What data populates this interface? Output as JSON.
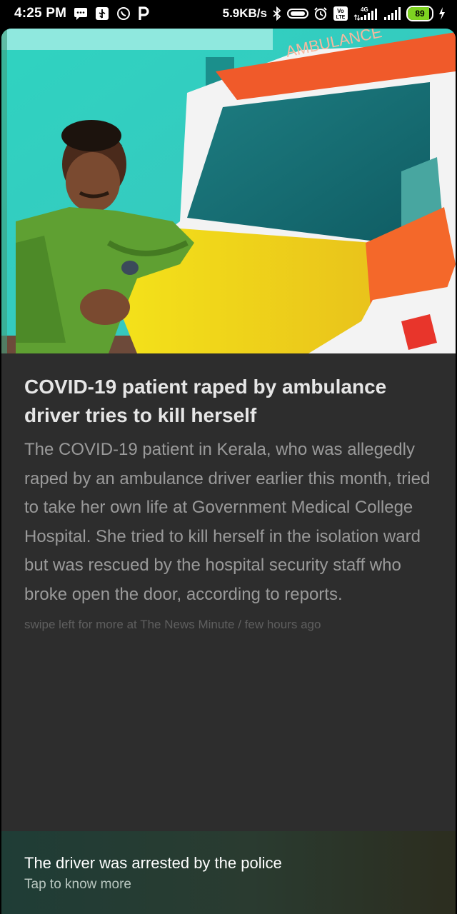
{
  "status_bar": {
    "time": "4:25 PM",
    "net_speed": "5.9KB/s",
    "battery_level": "89",
    "network_type": "4G",
    "volte_label": "Vo LTE",
    "icons": [
      "message-icon",
      "usb-icon",
      "whatsapp-icon",
      "p-icon",
      "bluetooth-icon",
      "vpn-key-icon",
      "alarm-icon",
      "volte-icon",
      "signal-icon",
      "signal-icon-2",
      "battery-icon",
      "charging-icon"
    ]
  },
  "article": {
    "title": "COVID-19 patient raped by ambulance driver tries to kill herself",
    "summary": "The COVID-19 patient in Kerala, who was allegedly raped by an ambulance driver earlier this month, tried to take her own life at Government Medical College Hospital. She tried to kill herself in the isolation ward but was rescued by the hospital security staff who broke open the door, according to reports.",
    "meta": "swipe left for more at The News Minute / few hours ago",
    "ambulance_text": "AMBULANCE"
  },
  "bottom_bar": {
    "title": "The driver was arrested by the police",
    "subtitle": "Tap to know more"
  },
  "colors": {
    "card_bg": "#2d2d2d",
    "title": "#e6e6e6",
    "summary": "#9a9a9a",
    "battery_green": "#7ed321"
  }
}
